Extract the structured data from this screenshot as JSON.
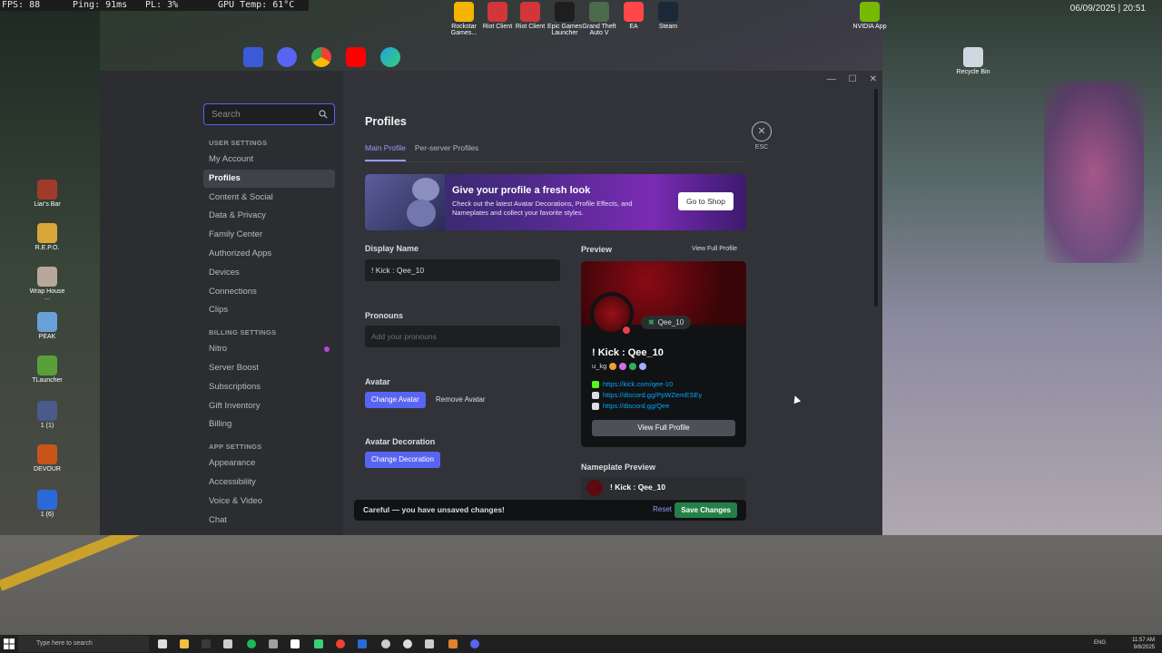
{
  "hud": {
    "fps": "FPS: 88",
    "ping": "Ping: 91ms",
    "pl": "PL: 3%",
    "gpu": "GPU Temp: 61°C"
  },
  "desktop_top_right_clock": "06/09/2025 | 20:51",
  "desktop_icons_top": [
    {
      "label": "Rockstar Games...",
      "color": "#f5b400"
    },
    {
      "label": "Riot Client",
      "color": "#d13639"
    },
    {
      "label": "Riot Client",
      "color": "#d13639"
    },
    {
      "label": "Epic Games Launcher",
      "color": "#1e1e1e"
    },
    {
      "label": "Grand Theft Auto V",
      "color": "#4b6b4a"
    },
    {
      "label": "EA",
      "color": "#ff4747"
    },
    {
      "label": "Steam",
      "color": "#1b2838"
    },
    {
      "label": "NVIDIA App",
      "color": "#76b900"
    }
  ],
  "desktop_icons_left": [
    {
      "label": "Liar's Bar",
      "color": "#a23a2a"
    },
    {
      "label": "R.E.P.O.",
      "color": "#d9a63a"
    },
    {
      "label": "Wrap House ...",
      "color": "#b8a89a"
    },
    {
      "label": "PEAK",
      "color": "#6aa0d8"
    },
    {
      "label": "TLauncher",
      "color": "#5aa03a"
    },
    {
      "label": "1 (1)",
      "color": "#4a5a8a"
    },
    {
      "label": "DEVOUR",
      "color": "#c8541a"
    },
    {
      "label": "1 (6)",
      "color": "#2a6ad8"
    }
  ],
  "recycle_bin": "Recycle Bin",
  "window": {
    "min": "—",
    "max": "☐",
    "close": "✕"
  },
  "search": {
    "placeholder": "Search"
  },
  "sidebar": {
    "user_settings_header": "USER SETTINGS",
    "user_items": [
      "My Account",
      "Profiles",
      "Content & Social",
      "Data & Privacy",
      "Family Center",
      "Authorized Apps",
      "Devices",
      "Connections",
      "Clips"
    ],
    "billing_header": "BILLING SETTINGS",
    "billing_items": [
      "Nitro",
      "Server Boost",
      "Subscriptions",
      "Gift Inventory",
      "Billing"
    ],
    "app_header": "APP SETTINGS",
    "app_items": [
      "Appearance",
      "Accessibility",
      "Voice & Video",
      "Chat"
    ]
  },
  "main": {
    "title": "Profiles",
    "tabs": [
      "Main Profile",
      "Per-server Profiles"
    ],
    "esc_label": "ESC",
    "banner": {
      "title": "Give your profile a fresh look",
      "desc": "Check out the latest Avatar Decorations, Profile Effects, and Nameplates and collect your favorite styles.",
      "button": "Go to Shop"
    },
    "display_name_label": "Display Name",
    "display_name_value": "! Kick : Qee_10",
    "pronouns_label": "Pronouns",
    "pronouns_placeholder": "Add your pronouns",
    "avatar_label": "Avatar",
    "change_avatar": "Change Avatar",
    "remove_avatar": "Remove Avatar",
    "avatar_decoration_label": "Avatar Decoration",
    "change_decoration": "Change Decoration"
  },
  "preview": {
    "label": "Preview",
    "view_full_link": "View Full Profile",
    "badge_name": "Qee_10",
    "display_name": "! Kick : Qee_10",
    "username": "u_kg",
    "links": [
      "https://kick.com/qee-10",
      "https://discord.gg/PpWZemESEy",
      "https://discord.gg/Qee"
    ],
    "view_full_button": "View Full Profile",
    "nameplate_label": "Nameplate Preview",
    "nameplate_name": "! Kick : Qee_10"
  },
  "unsaved": {
    "message": "Careful — you have unsaved changes!",
    "reset": "Reset",
    "save": "Save Changes"
  },
  "taskbar": {
    "search_placeholder": "Type here to search",
    "lang": "ENG",
    "time": "11:57 AM",
    "date": "9/8/2025"
  }
}
